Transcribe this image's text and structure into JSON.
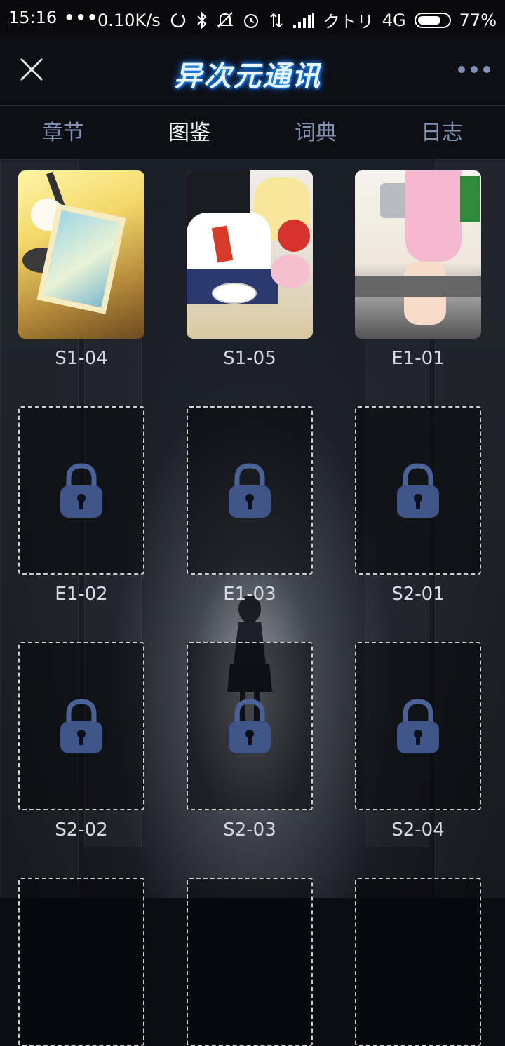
{
  "status_bar": {
    "time": "15:16",
    "dots": "•••",
    "net_speed": "0.10K/s",
    "carrier": "クトリ",
    "network": "4G",
    "battery_percent_text": "77%",
    "battery_level": 0.77
  },
  "header": {
    "logo_text": "异次元通讯"
  },
  "tabs": [
    {
      "label": "章节",
      "active": false
    },
    {
      "label": "图鉴",
      "active": true
    },
    {
      "label": "词典",
      "active": false
    },
    {
      "label": "日志",
      "active": false
    }
  ],
  "gallery": {
    "items": [
      {
        "label": "S1-04",
        "locked": false
      },
      {
        "label": "S1-05",
        "locked": false
      },
      {
        "label": "E1-01",
        "locked": false
      },
      {
        "label": "E1-02",
        "locked": true
      },
      {
        "label": "E1-03",
        "locked": true
      },
      {
        "label": "S2-01",
        "locked": true
      },
      {
        "label": "S2-02",
        "locked": true
      },
      {
        "label": "S2-03",
        "locked": true
      },
      {
        "label": "S2-04",
        "locked": true
      }
    ]
  },
  "colors": {
    "accent_blue": "#1e9bff",
    "tab_inactive": "#8091b5",
    "tab_active": "#f2f4f8",
    "lock_icon": "#3f5589"
  },
  "icons": [
    "close-icon",
    "more-icon",
    "lock-icon",
    "signal-icon",
    "wifi-icon",
    "bluetooth-icon",
    "alarm-icon",
    "mute-icon",
    "sync-icon",
    "battery-icon"
  ]
}
